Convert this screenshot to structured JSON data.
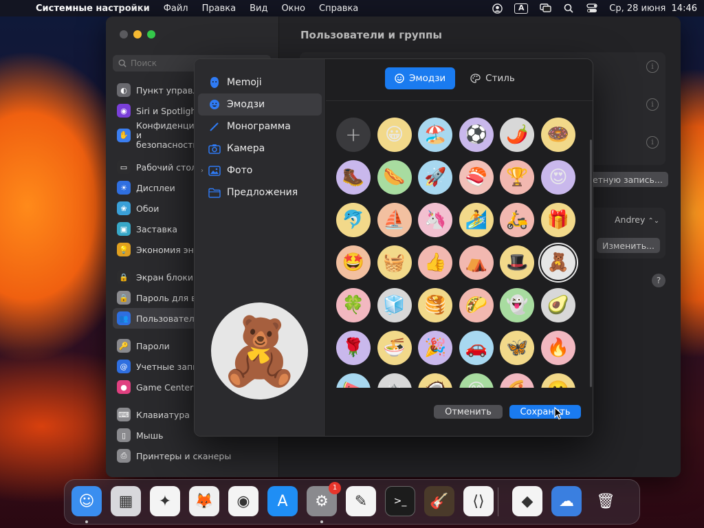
{
  "menubar": {
    "app_name": "Системные настройки",
    "menus": [
      "Файл",
      "Правка",
      "Вид",
      "Окно",
      "Справка"
    ],
    "input_source": "A",
    "datetime": "Ср, 28 июня  14:46"
  },
  "settings": {
    "title": "Пользователи и группы",
    "search_placeholder": "Поиск",
    "sidebar": [
      {
        "label": "Пункт управления",
        "icon": "control-center-icon",
        "color": "#6a6a6f"
      },
      {
        "label": "Siri и Spotlight",
        "icon": "siri-icon",
        "color": "#7a3fd9"
      },
      {
        "label": "Конфиденциальность и безопасность",
        "icon": "hand-icon",
        "color": "#3b7ef0",
        "double": true
      },
      {
        "label": "Рабочий стол и Dock",
        "icon": "dock-icon",
        "color": "#2c2c2e",
        "gap_before": true
      },
      {
        "label": "Дисплеи",
        "icon": "sun-icon",
        "color": "#2f6fe0"
      },
      {
        "label": "Обои",
        "icon": "wallpaper-icon",
        "color": "#3aa0d8"
      },
      {
        "label": "Заставка",
        "icon": "screensaver-icon",
        "color": "#38a8c8"
      },
      {
        "label": "Экономия энергии",
        "icon": "bulb-icon",
        "color": "#e0a020"
      },
      {
        "label": "Экран блокировки",
        "icon": "lock-screen-icon",
        "color": "#2c2c2e",
        "gap_before": true
      },
      {
        "label": "Пароль для входа",
        "icon": "lock-icon",
        "color": "#8a8a8e"
      },
      {
        "label": "Пользователи и группы",
        "icon": "users-icon",
        "color": "#2f6fe0",
        "active": true
      },
      {
        "label": "Пароли",
        "icon": "key-icon",
        "color": "#8a8a8e",
        "gap_before": true
      },
      {
        "label": "Учетные записи интернета",
        "icon": "at-icon",
        "color": "#2f6fe0"
      },
      {
        "label": "Game Center",
        "icon": "game-center-icon",
        "color": "#e04080"
      },
      {
        "label": "Клавиатура",
        "icon": "keyboard-icon",
        "color": "#8a8a8e",
        "gap_before": true
      },
      {
        "label": "Мышь",
        "icon": "mouse-icon",
        "color": "#8a8a8e"
      },
      {
        "label": "Принтеры и сканеры",
        "icon": "printer-icon",
        "color": "#8a8a8e"
      }
    ],
    "account_button": "етную запись...",
    "user_select": "Andrey",
    "edit_button": "Изменить...",
    "help": "?"
  },
  "dialog": {
    "sources": [
      {
        "label": "Memoji",
        "icon": "memoji-icon"
      },
      {
        "label": "Эмодзи",
        "icon": "emoji-icon",
        "active": true
      },
      {
        "label": "Монограмма",
        "icon": "pencil-icon"
      },
      {
        "label": "Камера",
        "icon": "camera-icon"
      },
      {
        "label": "Фото",
        "icon": "photos-icon",
        "expandable": true
      },
      {
        "label": "Предложения",
        "icon": "folder-icon"
      }
    ],
    "tabs": [
      {
        "label": "Эмодзи",
        "icon": "smiley-icon",
        "active": true
      },
      {
        "label": "Стиль",
        "icon": "palette-icon",
        "active": false
      }
    ],
    "preview_emoji": "🧸",
    "preview_bg": "#e6e6e6",
    "add_symbol": "+",
    "emojis": [
      {
        "e": "😀",
        "bg": "#f2d98a"
      },
      {
        "e": "🏖️",
        "bg": "#a8d8f0"
      },
      {
        "e": "⚽",
        "bg": "#c9b8ec"
      },
      {
        "e": "🌶️",
        "bg": "#d8d8d8"
      },
      {
        "e": "🍩",
        "bg": "#f2d98a"
      },
      {
        "e": "🥾",
        "bg": "#c9b8ec"
      },
      {
        "e": "🌭",
        "bg": "#a8dca0"
      },
      {
        "e": "🚀",
        "bg": "#a8d8f0"
      },
      {
        "e": "🍣",
        "bg": "#f2c0b8"
      },
      {
        "e": "🏆",
        "bg": "#f2b8b0"
      },
      {
        "e": "😍",
        "bg": "#c9b8ec"
      },
      {
        "e": "🐬",
        "bg": "#f2d98a"
      },
      {
        "e": "⛵",
        "bg": "#f2c0a0"
      },
      {
        "e": "🦄",
        "bg": "#f2c0d0"
      },
      {
        "e": "🏄",
        "bg": "#f2d98a"
      },
      {
        "e": "🛵",
        "bg": "#f2b8b0"
      },
      {
        "e": "🎁",
        "bg": "#f2d98a"
      },
      {
        "e": "🤩",
        "bg": "#f2c0a0"
      },
      {
        "e": "🧺",
        "bg": "#f2d98a"
      },
      {
        "e": "👍",
        "bg": "#f2b8b0"
      },
      {
        "e": "⛺",
        "bg": "#f2b8b0"
      },
      {
        "e": "🎩",
        "bg": "#f2d98a"
      },
      {
        "e": "🧸",
        "bg": "#e6e6e6",
        "selected": true
      },
      {
        "e": "🍀",
        "bg": "#f2b8c0"
      },
      {
        "e": "🧊",
        "bg": "#d8d8d8"
      },
      {
        "e": "🥞",
        "bg": "#f2d98a"
      },
      {
        "e": "🌮",
        "bg": "#f2b8b0"
      },
      {
        "e": "👻",
        "bg": "#a8dca0"
      },
      {
        "e": "🥑",
        "bg": "#d8d8d8"
      },
      {
        "e": "🌹",
        "bg": "#c9b8ec"
      },
      {
        "e": "🍜",
        "bg": "#f2d98a"
      },
      {
        "e": "🎉",
        "bg": "#c9b8ec"
      },
      {
        "e": "🚗",
        "bg": "#a8d8f0"
      },
      {
        "e": "🦋",
        "bg": "#f2d98a"
      },
      {
        "e": "🔥",
        "bg": "#f2b8c0"
      },
      {
        "e": "🍉",
        "bg": "#a8d8f0"
      },
      {
        "e": "⛰️",
        "bg": "#d8d8d8"
      },
      {
        "e": "🥥",
        "bg": "#f2d98a"
      },
      {
        "e": "😊",
        "bg": "#a8dca0"
      },
      {
        "e": "🍕",
        "bg": "#f2b8c0"
      },
      {
        "e": "🙂",
        "bg": "#f2d98a"
      }
    ],
    "cancel": "Отменить",
    "save": "Сохранить"
  },
  "dock": [
    {
      "name": "finder",
      "color": "#3a8ef0",
      "glyph": "☺",
      "running": true
    },
    {
      "name": "launchpad",
      "color": "#d8d8dc",
      "glyph": "▦"
    },
    {
      "name": "safari",
      "color": "#f4f4f4",
      "glyph": "✦"
    },
    {
      "name": "firefox",
      "color": "#f0f0f0",
      "glyph": "🦊"
    },
    {
      "name": "chrome",
      "color": "#f4f4f4",
      "glyph": "◉"
    },
    {
      "name": "app-store",
      "color": "#1f8ef5",
      "glyph": "A"
    },
    {
      "name": "system-settings",
      "color": "#8a8a8e",
      "glyph": "⚙",
      "running": true,
      "badge": "1"
    },
    {
      "name": "textedit",
      "color": "#f4f4f4",
      "glyph": "✎"
    },
    {
      "name": "terminal",
      "color": "#1c1c1c",
      "glyph": ">_"
    },
    {
      "name": "garageband",
      "color": "#4a3a2a",
      "glyph": "🎸"
    },
    {
      "name": "vscode",
      "color": "#f4f4f4",
      "glyph": "⟨⟩"
    },
    {
      "name": "visual-studio",
      "color": "#f4f4f4",
      "glyph": "◆"
    },
    {
      "name": "weather",
      "color": "#3a7fe0",
      "glyph": "☁"
    },
    {
      "name": "trash",
      "color": "#555",
      "glyph": "🗑"
    }
  ]
}
